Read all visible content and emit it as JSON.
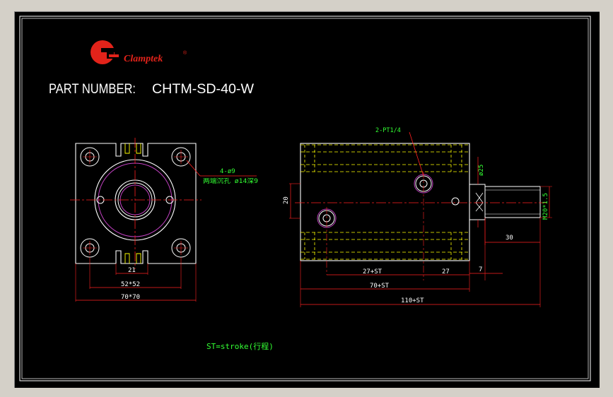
{
  "logo": {
    "brand": "Clamptek",
    "registered": "®",
    "colors": {
      "red": "#e2231a"
    }
  },
  "part_number": {
    "label": "PART NUMBER:",
    "value": "CHTM-SD-40-W"
  },
  "front_view": {
    "hole_note_line1": "4-ø9",
    "hole_note_line2": "两端沉孔 ø14深9",
    "dim_center": "21",
    "dim_pitch": "52*52",
    "dim_outer": "70*70"
  },
  "side_view": {
    "port_note": "2-PT1/4",
    "dim_height": "20",
    "dim_rod_dia": "ø25",
    "dim_thread": "M20*1.5",
    "dim_rod_len": "30",
    "dim_port_a": "27+ST",
    "dim_port_b": "27",
    "dim_step": "7",
    "dim_body": "70+ST",
    "dim_total": "110+ST"
  },
  "note": "ST=stroke(行程)",
  "colors": {
    "background": "#000000",
    "outline": "#ffffff",
    "hidden": "#ffff00",
    "dimension": "#ff2020",
    "text": "#33ff33",
    "arc": "#c040c0"
  }
}
